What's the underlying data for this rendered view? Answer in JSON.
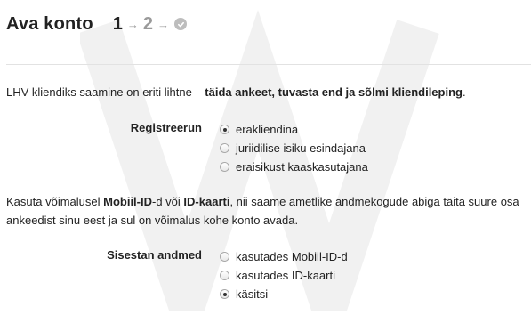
{
  "header": {
    "title": "Ava konto",
    "steps": [
      "1",
      "2"
    ],
    "active_step": "1"
  },
  "intro": {
    "text_plain": "LHV kliendiks saamine on eriti lihtne – ",
    "text_bold": "täida ankeet, tuvasta end ja sõlmi kliendileping",
    "text_end": "."
  },
  "register": {
    "label": "Registreerun",
    "options": [
      {
        "label": "erakliendina",
        "checked": true
      },
      {
        "label": "juriidilise isiku esindajana",
        "checked": false
      },
      {
        "label": "eraisikust kaaskasutajana",
        "checked": false
      }
    ]
  },
  "id_paragraph": {
    "part1": "Kasuta võimalusel ",
    "bold1": "Mobiil-ID",
    "part2": "-d või ",
    "bold2": "ID-kaarti",
    "part3": ", nii saame ametlike andmekogude abiga täita suure osa ankeedist sinu eest ja sul on võimalus kohe konto avada."
  },
  "data_entry": {
    "label": "Sisestan andmed",
    "options": [
      {
        "label": "kasutades Mobiil-ID-d",
        "checked": false
      },
      {
        "label": "kasutades ID-kaarti",
        "checked": false
      },
      {
        "label": "käsitsi",
        "checked": true
      }
    ]
  },
  "colors": {
    "text": "#222222",
    "muted": "#9a9a9a",
    "divider": "#e2e2e2"
  },
  "icons": {
    "step_arrow": "arrow-right-icon",
    "step_done": "check-circle-icon"
  }
}
